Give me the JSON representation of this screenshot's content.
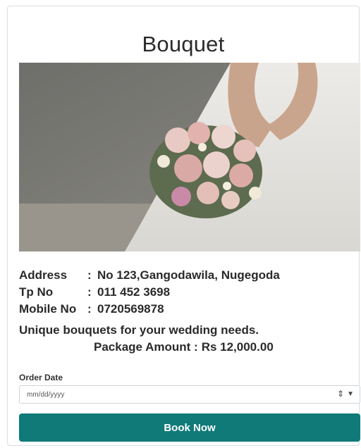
{
  "card": {
    "title": "Bouquet",
    "details": [
      {
        "label": "Address",
        "sep": ":",
        "value": "No 123,Gangodawila, Nugegoda"
      },
      {
        "label": "Tp No",
        "sep": ":",
        "value": "011 452 3698"
      },
      {
        "label": "Mobile No",
        "sep": ":",
        "value": "0720569878"
      }
    ],
    "description": "Unique bouquets for your wedding needs.",
    "package_label": "Package Amount :",
    "package_value": "Rs 12,000.00",
    "order_date_label": "Order Date",
    "order_date_placeholder": "mm/dd/yyyy",
    "book_button": "Book Now"
  },
  "colors": {
    "accent": "#0f7a78"
  }
}
